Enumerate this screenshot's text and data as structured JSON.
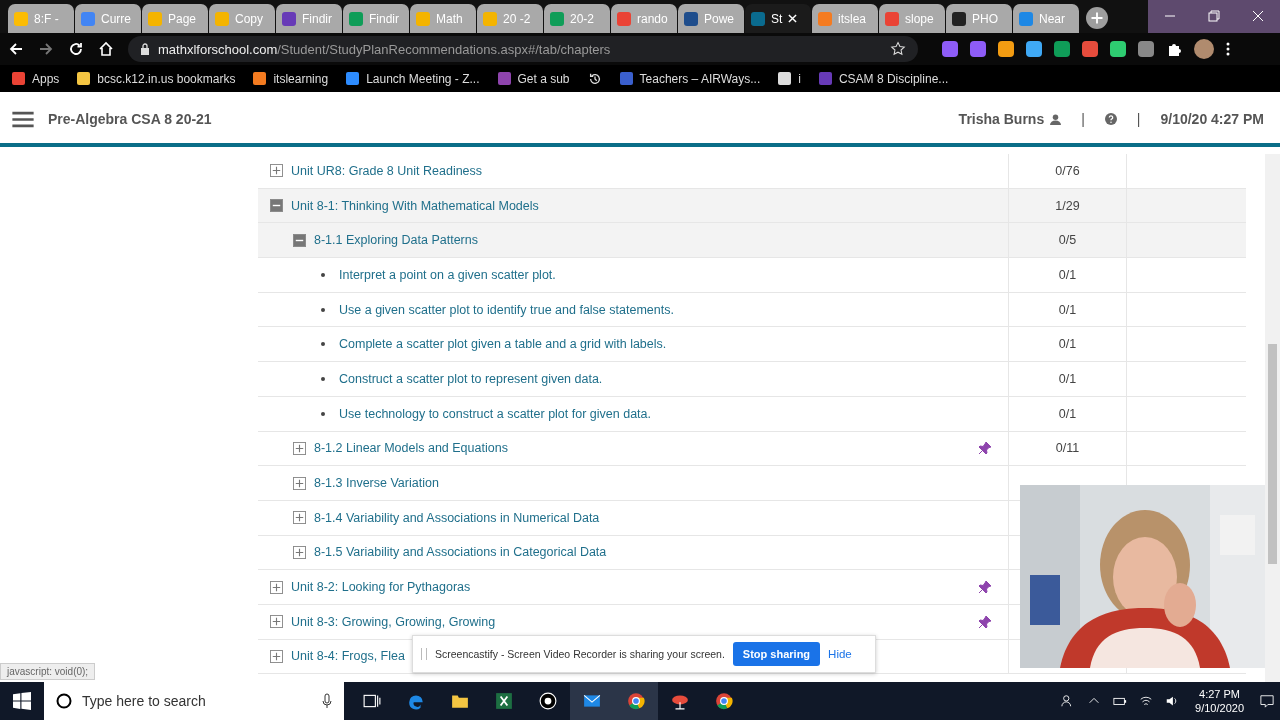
{
  "browser": {
    "tabs": [
      {
        "label": "8:F -",
        "color": "#fbbc04",
        "selected": false
      },
      {
        "label": "Curre",
        "color": "#4285f4",
        "selected": false
      },
      {
        "label": "Page",
        "color": "#f4b400",
        "selected": false
      },
      {
        "label": "Copy",
        "color": "#f4b400",
        "selected": false
      },
      {
        "label": "Findir",
        "color": "#673ab7",
        "selected": false
      },
      {
        "label": "Findir",
        "color": "#0f9d58",
        "selected": false
      },
      {
        "label": "Math",
        "color": "#f4b400",
        "selected": false
      },
      {
        "label": "20 -2",
        "color": "#f4b400",
        "selected": false
      },
      {
        "label": "20-2",
        "color": "#0f9d58",
        "selected": false
      },
      {
        "label": "rando",
        "color": "#ea4335",
        "selected": false
      },
      {
        "label": "Powe",
        "color": "#1e4d8c",
        "selected": false
      },
      {
        "label": "St",
        "color": "#0a6b8f",
        "selected": true
      },
      {
        "label": "itslea",
        "color": "#f47b20",
        "selected": false
      },
      {
        "label": "slope",
        "color": "#ea4335",
        "selected": false
      },
      {
        "label": "PHO",
        "color": "#222222",
        "selected": false
      },
      {
        "label": "Near",
        "color": "#1e88e5",
        "selected": false
      }
    ],
    "url_host": "mathxlforschool.com",
    "url_path": "/Student/StudyPlanRecommendations.aspx#/tab/chapters",
    "bookmarks": [
      {
        "kind": "link",
        "label": "Apps",
        "color": "#ea4335"
      },
      {
        "kind": "link",
        "label": "bcsc.k12.in.us bookmarks",
        "color": "#f4c542"
      },
      {
        "kind": "link",
        "label": "itslearning",
        "color": "#f47b20"
      },
      {
        "kind": "link",
        "label": "Launch Meeting - Z...",
        "color": "#2d8cff"
      },
      {
        "kind": "link",
        "label": "Get a sub",
        "color": "#8e44ad"
      },
      {
        "kind": "history"
      },
      {
        "kind": "link",
        "label": "Teachers – AIRWays...",
        "color": "#3a5fcd"
      },
      {
        "kind": "link",
        "label": "i",
        "color": "#dddddd"
      },
      {
        "kind": "link",
        "label": "CSAM 8 Discipline...",
        "color": "#673ab7"
      }
    ]
  },
  "header": {
    "course": "Pre-Algebra CSA 8 20-21",
    "user": "Trisha Burns",
    "separator_1": "|",
    "separator_2": "|",
    "datetime": "9/10/20 4:27 PM"
  },
  "rows": [
    {
      "kind": "unit",
      "title": "Unit UR8: Grade 8 Unit Readiness",
      "score": "0/76",
      "expanded": false,
      "pinned": false
    },
    {
      "kind": "unit",
      "title": "Unit 8-1: Thinking With Mathematical Models",
      "score": "1/29",
      "expanded": true,
      "pinned": false,
      "children": [
        {
          "kind": "section",
          "title": "8-1.1 Exploring Data Patterns",
          "score": "0/5",
          "expanded": true,
          "pinned": false,
          "children": [
            {
              "kind": "objective",
              "title": "Interpret a point on a given scatter plot.",
              "score": "0/1"
            },
            {
              "kind": "objective",
              "title": "Use a given scatter plot to identify true and false statements.",
              "score": "0/1"
            },
            {
              "kind": "objective",
              "title": "Complete a scatter plot given a table and a grid with labels.",
              "score": "0/1"
            },
            {
              "kind": "objective",
              "title": "Construct a scatter plot to represent given data.",
              "score": "0/1"
            },
            {
              "kind": "objective",
              "title": "Use technology to construct a scatter plot for given data.",
              "score": "0/1"
            }
          ]
        },
        {
          "kind": "section",
          "title": "8-1.2 Linear Models and Equations",
          "score": "0/11",
          "expanded": false,
          "pinned": true
        },
        {
          "kind": "section",
          "title": "8-1.3 Inverse Variation",
          "expanded": false,
          "pinned": false
        },
        {
          "kind": "section",
          "title": "8-1.4 Variability and Associations in Numerical Data",
          "expanded": false,
          "pinned": false
        },
        {
          "kind": "section",
          "title": "8-1.5 Variability and Associations in Categorical Data",
          "expanded": false,
          "pinned": false
        }
      ]
    },
    {
      "kind": "unit",
      "title": "Unit 8-2: Looking for Pythagoras",
      "expanded": false,
      "pinned": true
    },
    {
      "kind": "unit",
      "title": "Unit 8-3: Growing, Growing, Growing",
      "expanded": false,
      "pinned": true
    },
    {
      "kind": "unit",
      "title": "Unit 8-4: Frogs, Flea",
      "expanded": false,
      "pinned": false
    }
  ],
  "share_banner": {
    "message": "Screencastify - Screen Video Recorder is sharing your screen.",
    "stop_button": "Stop sharing",
    "hide_link": "Hide"
  },
  "status_text": "javascript: void(0);",
  "taskbar": {
    "search_placeholder": "Type here to search",
    "time": "4:27 PM",
    "date": "9/10/2020"
  }
}
